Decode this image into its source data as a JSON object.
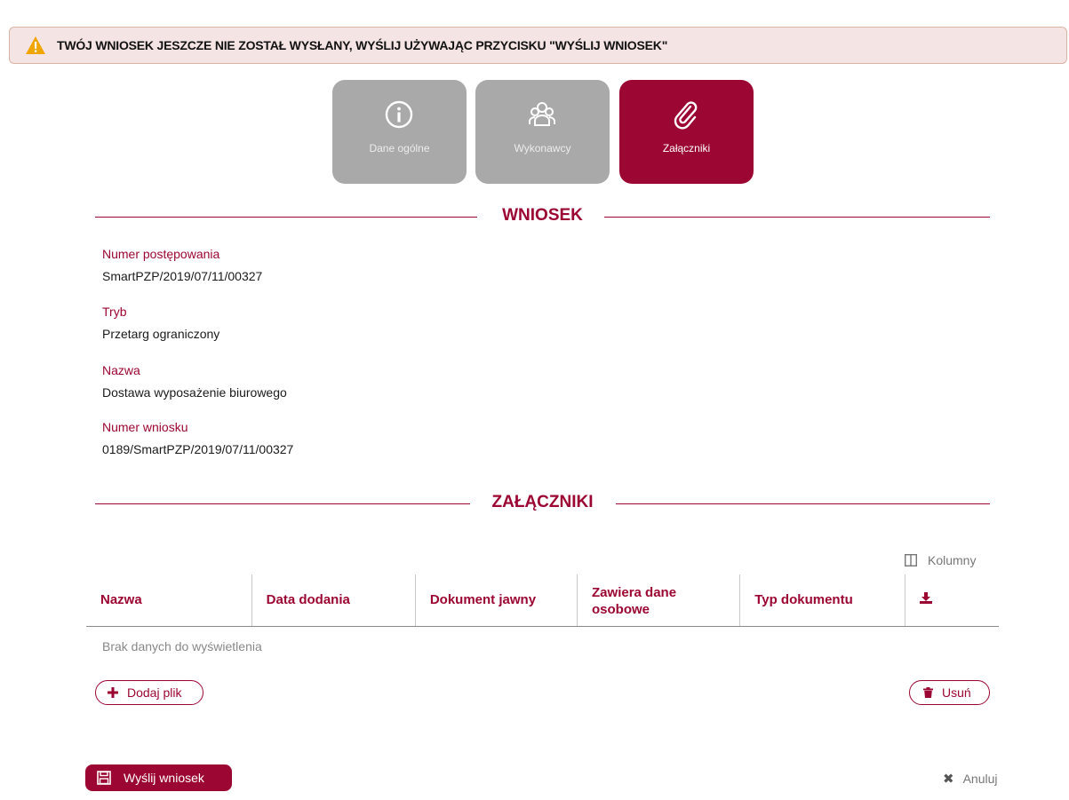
{
  "alert": {
    "message": "TWÓJ WNIOSEK JESZCZE NIE ZOSTAŁ WYSŁANY, WYŚLIJ UŻYWAJĄC PRZYCISKU \"WYŚLIJ WNIOSEK\"",
    "icon": "warning-icon",
    "color": "#f0a500"
  },
  "steps": [
    {
      "label": "Dane ogólne",
      "icon": "info-icon",
      "active": false
    },
    {
      "label": "Wykonawcy",
      "icon": "users-icon",
      "active": false
    },
    {
      "label": "Załączniki",
      "icon": "paperclip-icon",
      "active": true
    }
  ],
  "colors": {
    "accent": "#9c0632",
    "inactive_step": "#a9a9a9"
  },
  "wniosek": {
    "title": "WNIOSEK",
    "fields": [
      {
        "label": "Numer postępowania",
        "value": "SmartPZP/2019/07/11/00327"
      },
      {
        "label": "Tryb",
        "value": "Przetarg ograniczony"
      },
      {
        "label": "Nazwa",
        "value": "Dostawa wyposażenie biurowego"
      },
      {
        "label": "Numer wniosku",
        "value": "0189/SmartPZP/2019/07/11/00327"
      }
    ]
  },
  "zalaczniki": {
    "title": "ZAŁĄCZNIKI",
    "columns_button": "Kolumny",
    "headers": [
      "Nazwa",
      "Data dodania",
      "Dokument jawny",
      "Zawiera dane osobowe",
      "Typ dokumentu"
    ],
    "download_icon": "download-icon",
    "empty_text": "Brak danych do wyświetlenia",
    "add_button": "Dodaj plik",
    "delete_button": "Usuń"
  },
  "footer": {
    "send_button": "Wyślij wniosek",
    "cancel_button": "Anuluj"
  }
}
